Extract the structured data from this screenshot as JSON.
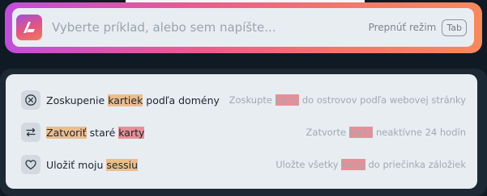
{
  "search": {
    "placeholder": "Vyberte príklad, alebo sem napíšte...",
    "mode_label": "Prepnúť režim",
    "mode_key": "Tab"
  },
  "results": [
    {
      "icon": "circle-x-icon",
      "title": [
        "Zoskupenie ",
        "kartiek",
        " podľa domény"
      ],
      "description": [
        "Zoskupte ",
        "karty",
        " do ostrovov podľa webovej stránky"
      ]
    },
    {
      "icon": "swap-arrows-icon",
      "title": [
        "Zatvoriť",
        " staré ",
        "karty"
      ],
      "description": [
        "Zatvorte ",
        "karty",
        " neaktívne 24 hodín"
      ]
    },
    {
      "icon": "heart-icon",
      "title": [
        "Uložiť moju ",
        "sessiu"
      ],
      "description": [
        "Uložte všetky ",
        "karty",
        " do priečinka záložiek"
      ]
    }
  ],
  "colors": {
    "gradient": [
      "#c04ed9",
      "#e95c8e",
      "#f7895d"
    ],
    "highlight_orange": "#ecbd8c",
    "highlight_red": "#e88f96"
  }
}
